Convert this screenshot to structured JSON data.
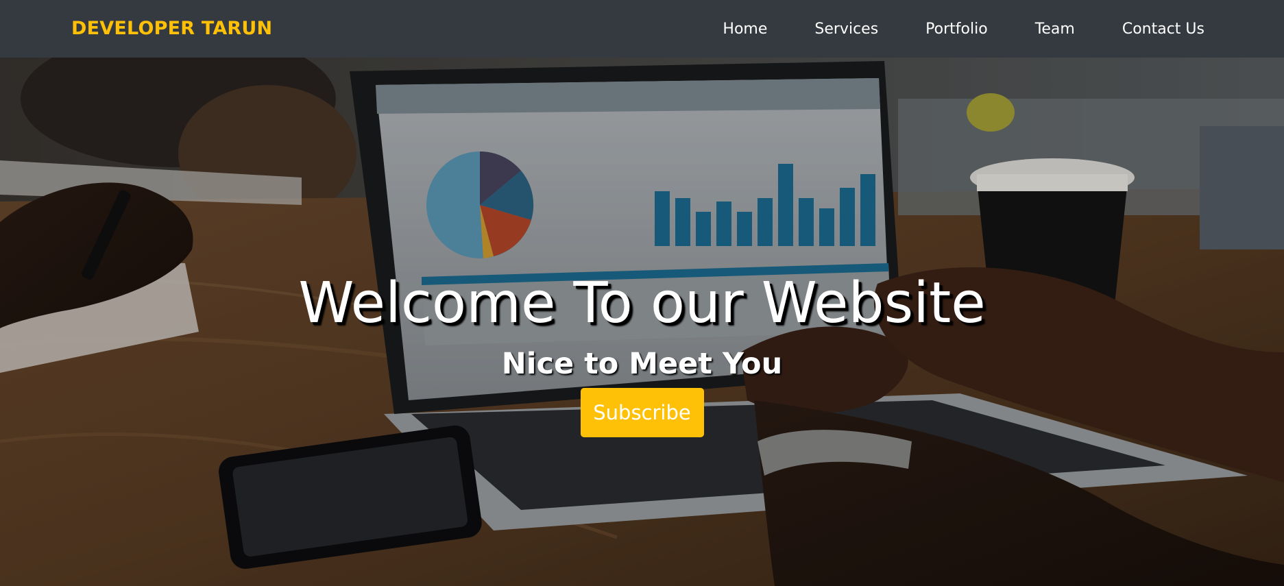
{
  "navbar": {
    "brand": "DEVELOPER TARUN",
    "links": [
      {
        "label": "Home"
      },
      {
        "label": "Services"
      },
      {
        "label": "Portfolio"
      },
      {
        "label": "Team"
      },
      {
        "label": "Contact Us"
      }
    ]
  },
  "hero": {
    "title": "Welcome To our Website",
    "subtitle": "Nice to Meet You",
    "button_label": "Subscribe"
  },
  "colors": {
    "navbar_bg": "#343a40",
    "accent": "#ffc107",
    "text": "#ffffff"
  }
}
